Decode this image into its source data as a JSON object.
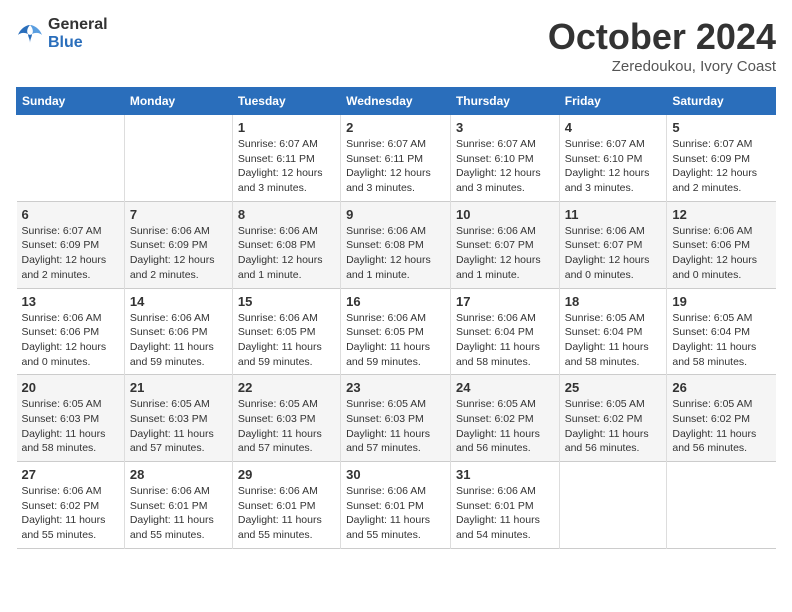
{
  "logo": {
    "general": "General",
    "blue": "Blue"
  },
  "title": "October 2024",
  "subtitle": "Zeredoukou, Ivory Coast",
  "headers": [
    "Sunday",
    "Monday",
    "Tuesday",
    "Wednesday",
    "Thursday",
    "Friday",
    "Saturday"
  ],
  "weeks": [
    [
      {
        "day": "",
        "info": ""
      },
      {
        "day": "",
        "info": ""
      },
      {
        "day": "1",
        "info": "Sunrise: 6:07 AM\nSunset: 6:11 PM\nDaylight: 12 hours and 3 minutes."
      },
      {
        "day": "2",
        "info": "Sunrise: 6:07 AM\nSunset: 6:11 PM\nDaylight: 12 hours and 3 minutes."
      },
      {
        "day": "3",
        "info": "Sunrise: 6:07 AM\nSunset: 6:10 PM\nDaylight: 12 hours and 3 minutes."
      },
      {
        "day": "4",
        "info": "Sunrise: 6:07 AM\nSunset: 6:10 PM\nDaylight: 12 hours and 3 minutes."
      },
      {
        "day": "5",
        "info": "Sunrise: 6:07 AM\nSunset: 6:09 PM\nDaylight: 12 hours and 2 minutes."
      }
    ],
    [
      {
        "day": "6",
        "info": "Sunrise: 6:07 AM\nSunset: 6:09 PM\nDaylight: 12 hours and 2 minutes."
      },
      {
        "day": "7",
        "info": "Sunrise: 6:06 AM\nSunset: 6:09 PM\nDaylight: 12 hours and 2 minutes."
      },
      {
        "day": "8",
        "info": "Sunrise: 6:06 AM\nSunset: 6:08 PM\nDaylight: 12 hours and 1 minute."
      },
      {
        "day": "9",
        "info": "Sunrise: 6:06 AM\nSunset: 6:08 PM\nDaylight: 12 hours and 1 minute."
      },
      {
        "day": "10",
        "info": "Sunrise: 6:06 AM\nSunset: 6:07 PM\nDaylight: 12 hours and 1 minute."
      },
      {
        "day": "11",
        "info": "Sunrise: 6:06 AM\nSunset: 6:07 PM\nDaylight: 12 hours and 0 minutes."
      },
      {
        "day": "12",
        "info": "Sunrise: 6:06 AM\nSunset: 6:06 PM\nDaylight: 12 hours and 0 minutes."
      }
    ],
    [
      {
        "day": "13",
        "info": "Sunrise: 6:06 AM\nSunset: 6:06 PM\nDaylight: 12 hours and 0 minutes."
      },
      {
        "day": "14",
        "info": "Sunrise: 6:06 AM\nSunset: 6:06 PM\nDaylight: 11 hours and 59 minutes."
      },
      {
        "day": "15",
        "info": "Sunrise: 6:06 AM\nSunset: 6:05 PM\nDaylight: 11 hours and 59 minutes."
      },
      {
        "day": "16",
        "info": "Sunrise: 6:06 AM\nSunset: 6:05 PM\nDaylight: 11 hours and 59 minutes."
      },
      {
        "day": "17",
        "info": "Sunrise: 6:06 AM\nSunset: 6:04 PM\nDaylight: 11 hours and 58 minutes."
      },
      {
        "day": "18",
        "info": "Sunrise: 6:05 AM\nSunset: 6:04 PM\nDaylight: 11 hours and 58 minutes."
      },
      {
        "day": "19",
        "info": "Sunrise: 6:05 AM\nSunset: 6:04 PM\nDaylight: 11 hours and 58 minutes."
      }
    ],
    [
      {
        "day": "20",
        "info": "Sunrise: 6:05 AM\nSunset: 6:03 PM\nDaylight: 11 hours and 58 minutes."
      },
      {
        "day": "21",
        "info": "Sunrise: 6:05 AM\nSunset: 6:03 PM\nDaylight: 11 hours and 57 minutes."
      },
      {
        "day": "22",
        "info": "Sunrise: 6:05 AM\nSunset: 6:03 PM\nDaylight: 11 hours and 57 minutes."
      },
      {
        "day": "23",
        "info": "Sunrise: 6:05 AM\nSunset: 6:03 PM\nDaylight: 11 hours and 57 minutes."
      },
      {
        "day": "24",
        "info": "Sunrise: 6:05 AM\nSunset: 6:02 PM\nDaylight: 11 hours and 56 minutes."
      },
      {
        "day": "25",
        "info": "Sunrise: 6:05 AM\nSunset: 6:02 PM\nDaylight: 11 hours and 56 minutes."
      },
      {
        "day": "26",
        "info": "Sunrise: 6:05 AM\nSunset: 6:02 PM\nDaylight: 11 hours and 56 minutes."
      }
    ],
    [
      {
        "day": "27",
        "info": "Sunrise: 6:06 AM\nSunset: 6:02 PM\nDaylight: 11 hours and 55 minutes."
      },
      {
        "day": "28",
        "info": "Sunrise: 6:06 AM\nSunset: 6:01 PM\nDaylight: 11 hours and 55 minutes."
      },
      {
        "day": "29",
        "info": "Sunrise: 6:06 AM\nSunset: 6:01 PM\nDaylight: 11 hours and 55 minutes."
      },
      {
        "day": "30",
        "info": "Sunrise: 6:06 AM\nSunset: 6:01 PM\nDaylight: 11 hours and 55 minutes."
      },
      {
        "day": "31",
        "info": "Sunrise: 6:06 AM\nSunset: 6:01 PM\nDaylight: 11 hours and 54 minutes."
      },
      {
        "day": "",
        "info": ""
      },
      {
        "day": "",
        "info": ""
      }
    ]
  ]
}
